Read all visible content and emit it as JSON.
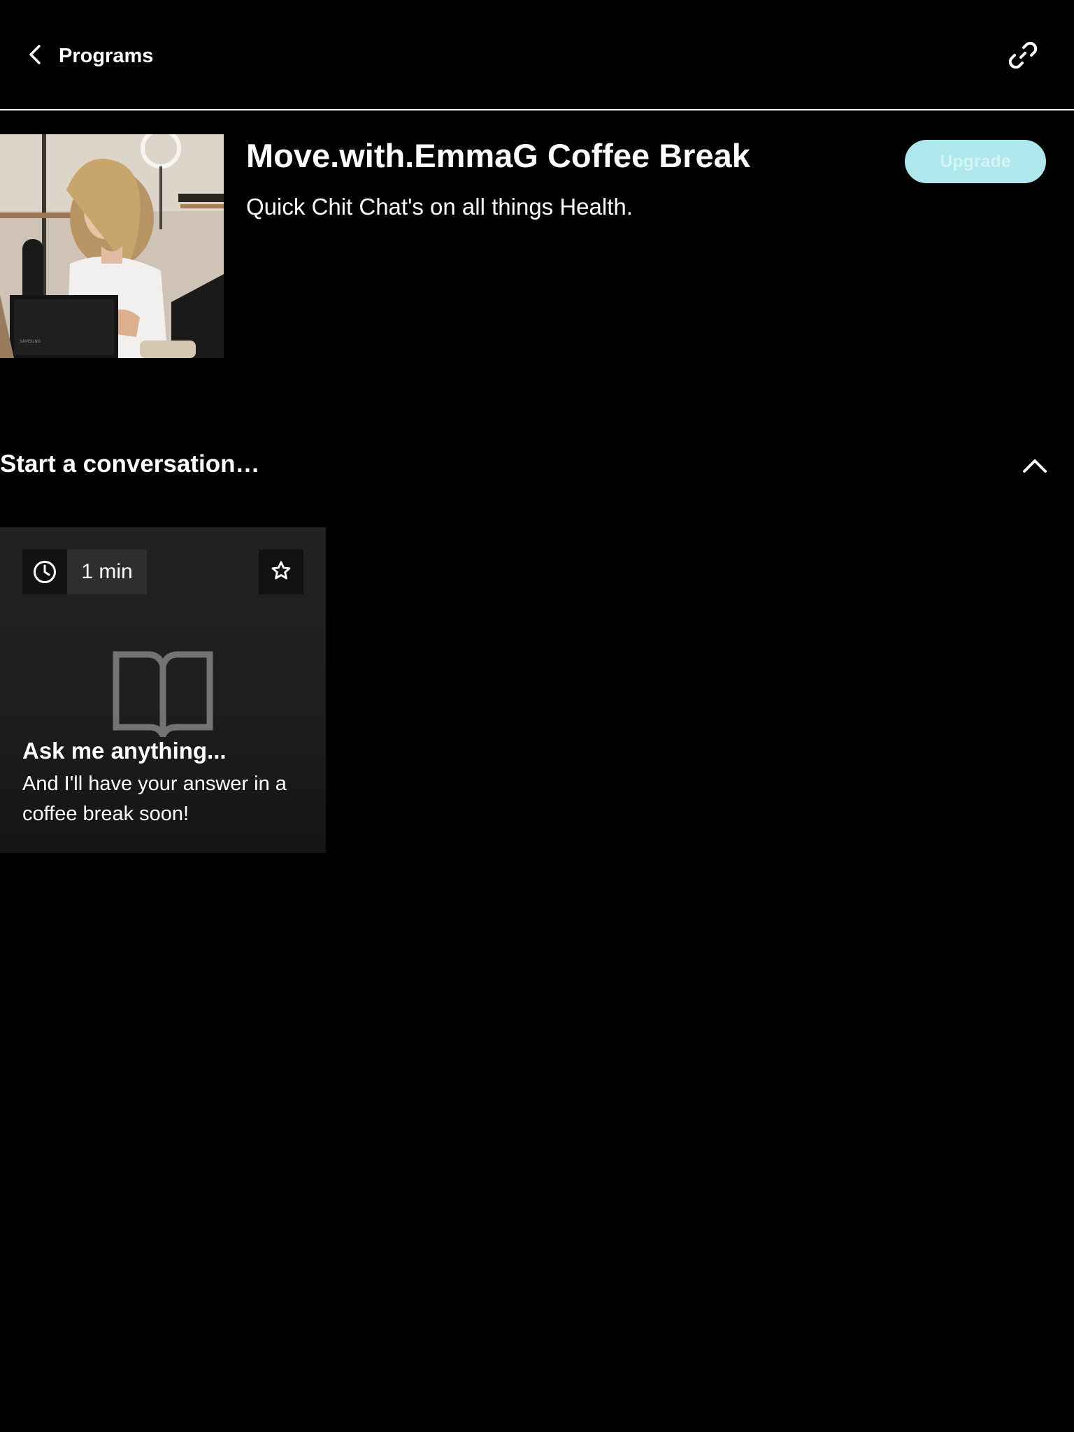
{
  "header": {
    "back_label": "Programs"
  },
  "program": {
    "title": "Move.with.EmmaG Coffee Break",
    "subtitle": "Quick Chit Chat's on all things Health.",
    "upgrade_label": "Upgrade",
    "accent_color": "#aee8ec"
  },
  "section": {
    "title": "Start a conversation…"
  },
  "cards": [
    {
      "duration": "1 min",
      "title": "Ask me anything...",
      "description": "And I'll have your answer in a coffee break soon!",
      "icon": "book-icon"
    }
  ],
  "icons": {
    "back": "chevron-left-icon",
    "share": "link-icon",
    "collapse": "chevron-up-icon",
    "duration": "clock-icon",
    "favorite": "star-icon"
  }
}
